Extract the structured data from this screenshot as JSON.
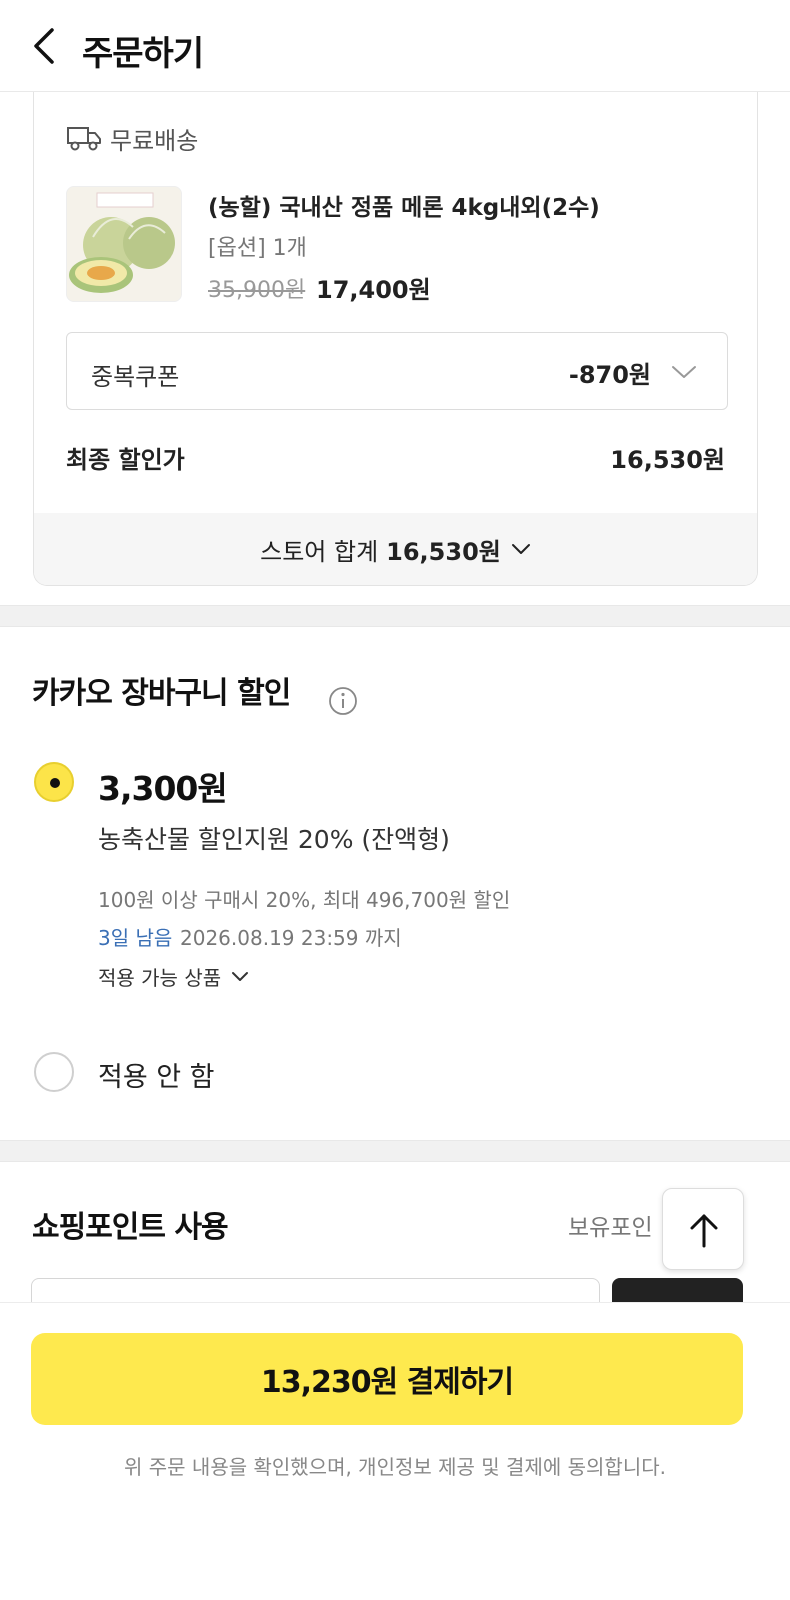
{
  "header": {
    "title": "주문하기"
  },
  "store": {
    "shipping_label": "무료배송",
    "product": {
      "name": "(농할) 국내산 정품 메론 4kg내외(2수)",
      "option": "[옵션] 1개",
      "original_price": "35,900원",
      "sale_price": "17,400원"
    },
    "coupon": {
      "label": "중복쿠폰",
      "value": "-870원"
    },
    "final": {
      "label": "최종 할인가",
      "value": "16,530원"
    },
    "total": {
      "label": "스토어 합계",
      "value": "16,530원"
    }
  },
  "kakao_discount": {
    "title": "카카오 장바구니 할인",
    "option_selected": {
      "amount": "3,300원",
      "description": "농축산물 할인지원 20% (잔액형)",
      "condition": "100원 이상 구매시 20%, 최대 496,700원 할인",
      "days_left": "3일 남음",
      "deadline": "2026.08.19 23:59 까지",
      "applicable_products": "적용 가능 상품"
    },
    "option_none": "적용 안 함"
  },
  "points": {
    "title": "쇼핑포인트 사용",
    "held_label": "보유포인"
  },
  "footer": {
    "pay_button": "13,230원 결제하기",
    "agreement": "위 주문 내용을 확인했으며, 개인정보 제공 및 결제에 동의합니다."
  },
  "colors": {
    "accent_yellow": "#fee94e",
    "link_blue": "#3a6fb5"
  }
}
